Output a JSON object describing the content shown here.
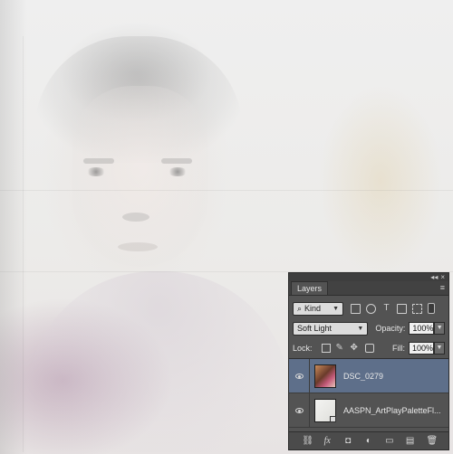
{
  "panel": {
    "title": "Layers",
    "collapse_glyph": "◂◂",
    "close_glyph": "×",
    "menu_glyph": "≡",
    "kind_filter": "Kind",
    "blend_mode": "Soft Light",
    "opacity_label": "Opacity:",
    "opacity_value": "100%",
    "lock_label": "Lock:",
    "fill_label": "Fill:",
    "fill_value": "100%"
  },
  "layers": [
    {
      "name": "DSC_0279",
      "selected": true
    },
    {
      "name": "AASPN_ArtPlayPaletteFl...",
      "selected": false
    }
  ],
  "icons": {
    "filter_icons": [
      "image-filter-icon",
      "adjustment-filter-icon",
      "type-filter-icon",
      "shape-filter-icon",
      "smart-object-filter-icon"
    ],
    "lock_icons": [
      "lock-transparent-icon",
      "lock-image-icon",
      "lock-position-icon",
      "lock-all-icon"
    ],
    "bottom_icons": [
      "link-layers-icon",
      "fx-icon",
      "add-mask-icon",
      "adjustment-layer-icon",
      "group-folder-icon",
      "new-layer-icon",
      "trash-icon"
    ]
  },
  "colors": {
    "panel_bg": "#535353",
    "selected_layer": "#5e6f8a"
  }
}
